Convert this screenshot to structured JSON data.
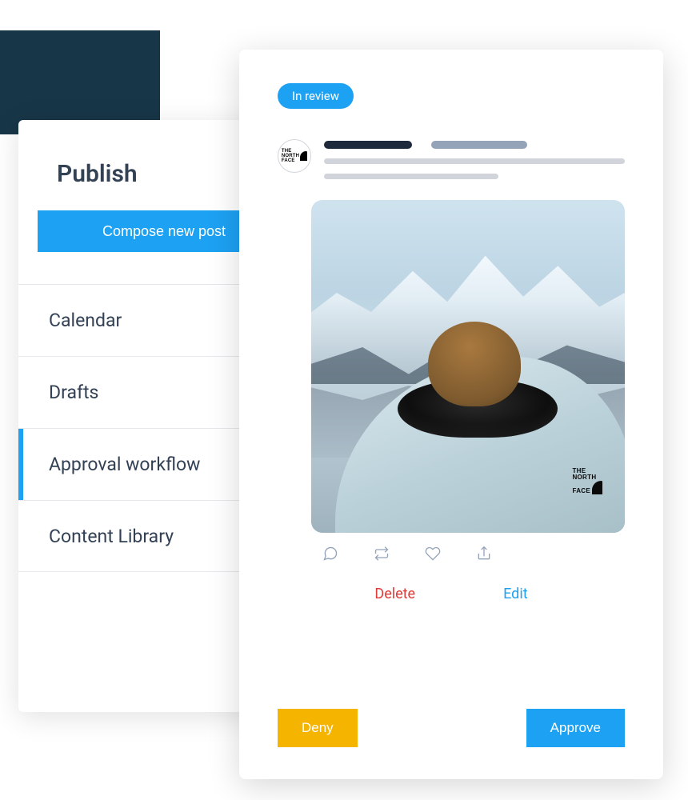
{
  "sidebar": {
    "title": "Publish",
    "compose_label": "Compose new post",
    "items": [
      {
        "label": "Calendar",
        "active": false
      },
      {
        "label": "Drafts",
        "active": false
      },
      {
        "label": "Approval workflow",
        "active": true
      },
      {
        "label": "Content Library",
        "active": false
      }
    ]
  },
  "review_card": {
    "status_label": "In review",
    "brand_name": "The North Face",
    "engagement_icons": [
      "comment",
      "retweet",
      "like",
      "share"
    ],
    "actions": {
      "delete_label": "Delete",
      "edit_label": "Edit",
      "deny_label": "Deny",
      "approve_label": "Approve"
    }
  },
  "colors": {
    "primary": "#1da1f2",
    "warning": "#f5b400",
    "danger": "#e03b3b"
  }
}
